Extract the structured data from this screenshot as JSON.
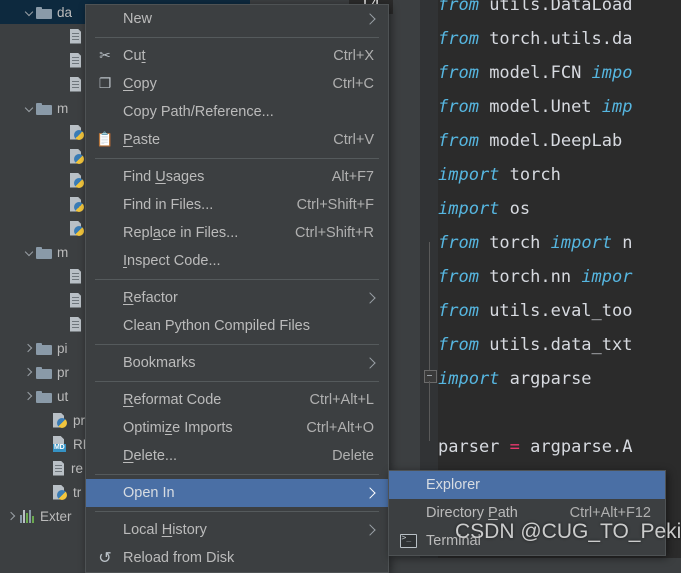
{
  "app": {
    "theme_bg": "#3c3f41",
    "editor_bg": "#2b2b2b",
    "accent_selection": "#4a6fa5",
    "tree_selection": "#0d293e"
  },
  "project_tree": {
    "name": "project-tool-window",
    "items": [
      {
        "label": "da",
        "icon": "folder-icon",
        "twisty": "open",
        "indent": 1,
        "selected": true
      },
      {
        "label": "",
        "icon": "file-icon",
        "twisty": "none",
        "indent": 3,
        "selected": false
      },
      {
        "label": "",
        "icon": "file-icon",
        "twisty": "none",
        "indent": 3,
        "selected": false
      },
      {
        "label": "",
        "icon": "file-icon",
        "twisty": "none",
        "indent": 3,
        "selected": false
      },
      {
        "label": "m",
        "icon": "folder-icon",
        "twisty": "open",
        "indent": 1,
        "selected": false
      },
      {
        "label": "",
        "icon": "python-file-icon",
        "twisty": "none",
        "indent": 3,
        "selected": false
      },
      {
        "label": "",
        "icon": "python-file-icon",
        "twisty": "none",
        "indent": 3,
        "selected": false
      },
      {
        "label": "",
        "icon": "python-file-icon",
        "twisty": "none",
        "indent": 3,
        "selected": false
      },
      {
        "label": "",
        "icon": "python-file-icon",
        "twisty": "none",
        "indent": 3,
        "selected": false
      },
      {
        "label": "",
        "icon": "python-file-icon",
        "twisty": "none",
        "indent": 3,
        "selected": false
      },
      {
        "label": "m",
        "icon": "folder-icon",
        "twisty": "open",
        "indent": 1,
        "selected": false
      },
      {
        "label": "",
        "icon": "file-icon",
        "twisty": "none",
        "indent": 3,
        "selected": false
      },
      {
        "label": "",
        "icon": "file-icon",
        "twisty": "none",
        "indent": 3,
        "selected": false
      },
      {
        "label": "",
        "icon": "file-icon",
        "twisty": "none",
        "indent": 3,
        "selected": false
      },
      {
        "label": "pi",
        "icon": "folder-icon",
        "twisty": "closed",
        "indent": 1,
        "selected": false
      },
      {
        "label": "pr",
        "icon": "folder-icon",
        "twisty": "closed",
        "indent": 1,
        "selected": false
      },
      {
        "label": "ut",
        "icon": "folder-icon",
        "twisty": "closed",
        "indent": 1,
        "selected": false
      },
      {
        "label": "pr",
        "icon": "python-file-icon",
        "twisty": "none",
        "indent": 2,
        "selected": false
      },
      {
        "label": "RE",
        "icon": "markdown-file-icon",
        "twisty": "none",
        "indent": 2,
        "selected": false
      },
      {
        "label": "re",
        "icon": "file-icon",
        "twisty": "none",
        "indent": 2,
        "selected": false
      },
      {
        "label": "tr",
        "icon": "python-file-icon",
        "twisty": "none",
        "indent": 2,
        "selected": false
      },
      {
        "label": "Exter",
        "icon": "external-libraries-icon",
        "twisty": "closed",
        "indent": 0,
        "selected": false
      }
    ]
  },
  "editor": {
    "line_number_chip": "14",
    "lines": [
      {
        "segments": [
          {
            "t": "from ",
            "c": "kw"
          },
          {
            "t": "utils.DataLoad",
            "c": "pl"
          }
        ]
      },
      {
        "segments": [
          {
            "t": "from ",
            "c": "kw"
          },
          {
            "t": "torch.utils.da",
            "c": "pl"
          }
        ]
      },
      {
        "segments": [
          {
            "t": "from ",
            "c": "kw"
          },
          {
            "t": "model.FCN ",
            "c": "pl"
          },
          {
            "t": "impo",
            "c": "kw"
          }
        ]
      },
      {
        "segments": [
          {
            "t": "from ",
            "c": "kw"
          },
          {
            "t": "model.Unet ",
            "c": "pl"
          },
          {
            "t": "imp",
            "c": "kw"
          }
        ]
      },
      {
        "segments": [
          {
            "t": "from ",
            "c": "kw"
          },
          {
            "t": "model.DeepLab ",
            "c": "pl"
          }
        ]
      },
      {
        "segments": [
          {
            "t": "import ",
            "c": "kw"
          },
          {
            "t": "torch",
            "c": "pl"
          }
        ]
      },
      {
        "segments": [
          {
            "t": "import ",
            "c": "kw"
          },
          {
            "t": "os",
            "c": "pl"
          }
        ]
      },
      {
        "segments": [
          {
            "t": "from ",
            "c": "kw"
          },
          {
            "t": "torch ",
            "c": "pl"
          },
          {
            "t": "import ",
            "c": "kw"
          },
          {
            "t": "n",
            "c": "pl"
          }
        ]
      },
      {
        "segments": [
          {
            "t": "from ",
            "c": "kw"
          },
          {
            "t": "torch.nn ",
            "c": "pl"
          },
          {
            "t": "impor",
            "c": "kw"
          }
        ]
      },
      {
        "segments": [
          {
            "t": "from ",
            "c": "kw"
          },
          {
            "t": "utils.eval_too",
            "c": "pl"
          }
        ]
      },
      {
        "segments": [
          {
            "t": "from ",
            "c": "kw"
          },
          {
            "t": "utils.data_txt",
            "c": "pl"
          }
        ]
      },
      {
        "segments": [
          {
            "t": "import ",
            "c": "kw"
          },
          {
            "t": "argparse",
            "c": "pl"
          }
        ]
      },
      {
        "segments": [
          {
            "t": "",
            "c": "pl"
          }
        ]
      },
      {
        "segments": [
          {
            "t": "parser ",
            "c": "pl"
          },
          {
            "t": "=",
            "c": "op"
          },
          {
            "t": " argparse.A",
            "c": "pl"
          }
        ]
      }
    ]
  },
  "context_menu": {
    "name": "project-context-menu",
    "items": [
      {
        "type": "item",
        "label": "New",
        "mnemonic": "",
        "shortcut": "",
        "icon": "",
        "submenu": true,
        "selected": false
      },
      {
        "type": "sep"
      },
      {
        "type": "item",
        "label": "Cut",
        "mnemonic": "t",
        "shortcut": "Ctrl+X",
        "icon": "scissors-icon",
        "submenu": false,
        "selected": false
      },
      {
        "type": "item",
        "label": "Copy",
        "mnemonic": "C",
        "shortcut": "Ctrl+C",
        "icon": "copy-icon",
        "submenu": false,
        "selected": false
      },
      {
        "type": "item",
        "label": "Copy Path/Reference...",
        "mnemonic": "",
        "shortcut": "",
        "icon": "",
        "submenu": false,
        "selected": false
      },
      {
        "type": "item",
        "label": "Paste",
        "mnemonic": "P",
        "shortcut": "Ctrl+V",
        "icon": "clipboard-icon",
        "submenu": false,
        "selected": false
      },
      {
        "type": "sep"
      },
      {
        "type": "item",
        "label": "Find Usages",
        "mnemonic": "U",
        "shortcut": "Alt+F7",
        "icon": "",
        "submenu": false,
        "selected": false
      },
      {
        "type": "item",
        "label": "Find in Files...",
        "mnemonic": "",
        "shortcut": "Ctrl+Shift+F",
        "icon": "",
        "submenu": false,
        "selected": false
      },
      {
        "type": "item",
        "label": "Replace in Files...",
        "mnemonic": "a",
        "shortcut": "Ctrl+Shift+R",
        "icon": "",
        "submenu": false,
        "selected": false
      },
      {
        "type": "item",
        "label": "Inspect Code...",
        "mnemonic": "I",
        "shortcut": "",
        "icon": "",
        "submenu": false,
        "selected": false
      },
      {
        "type": "sep"
      },
      {
        "type": "item",
        "label": "Refactor",
        "mnemonic": "R",
        "shortcut": "",
        "icon": "",
        "submenu": true,
        "selected": false
      },
      {
        "type": "item",
        "label": "Clean Python Compiled Files",
        "mnemonic": "",
        "shortcut": "",
        "icon": "",
        "submenu": false,
        "selected": false
      },
      {
        "type": "sep"
      },
      {
        "type": "item",
        "label": "Bookmarks",
        "mnemonic": "",
        "shortcut": "",
        "icon": "",
        "submenu": true,
        "selected": false
      },
      {
        "type": "sep"
      },
      {
        "type": "item",
        "label": "Reformat Code",
        "mnemonic": "R",
        "shortcut": "Ctrl+Alt+L",
        "icon": "",
        "submenu": false,
        "selected": false
      },
      {
        "type": "item",
        "label": "Optimize Imports",
        "mnemonic": "z",
        "shortcut": "Ctrl+Alt+O",
        "icon": "",
        "submenu": false,
        "selected": false
      },
      {
        "type": "item",
        "label": "Delete...",
        "mnemonic": "D",
        "shortcut": "Delete",
        "icon": "",
        "submenu": false,
        "selected": false
      },
      {
        "type": "sep"
      },
      {
        "type": "item",
        "label": "Open In",
        "mnemonic": "",
        "shortcut": "",
        "icon": "",
        "submenu": true,
        "selected": true
      },
      {
        "type": "sep"
      },
      {
        "type": "item",
        "label": "Local History",
        "mnemonic": "H",
        "shortcut": "",
        "icon": "",
        "submenu": true,
        "selected": false
      },
      {
        "type": "item",
        "label": "Reload from Disk",
        "mnemonic": "",
        "shortcut": "",
        "icon": "reload-icon",
        "submenu": false,
        "selected": false
      }
    ]
  },
  "submenu": {
    "name": "open-in-submenu",
    "items": [
      {
        "label": "Explorer",
        "shortcut": "",
        "icon": "",
        "mnemonic": "",
        "selected": true
      },
      {
        "label": "Directory Path",
        "shortcut": "Ctrl+Alt+F12",
        "icon": "",
        "mnemonic": "P",
        "selected": false
      },
      {
        "label": "Terminal",
        "shortcut": "",
        "icon": "terminal-icon",
        "mnemonic": "",
        "selected": false
      }
    ]
  },
  "watermark": {
    "text": "CSDN @CUG_TO_Peking"
  }
}
